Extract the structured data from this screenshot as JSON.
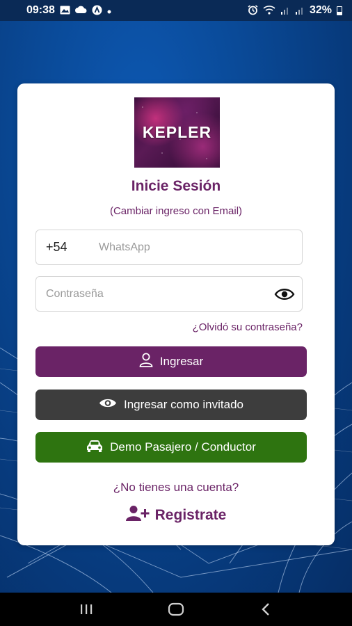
{
  "status_bar": {
    "time": "09:38",
    "battery_percent": "32%",
    "icons_left": [
      "image-icon",
      "cloud-icon",
      "app-a-icon",
      "dot-icon"
    ],
    "icons_right": [
      "alarm-icon",
      "wifi-icon",
      "signal-icon",
      "signal-icon",
      "battery-icon"
    ]
  },
  "logo": {
    "text": "KEPLER"
  },
  "login": {
    "title": "Inicie Sesión",
    "switch_label": "(Cambiar ingreso con Email)",
    "phone_prefix": "+54",
    "phone_placeholder": "WhatsApp",
    "password_placeholder": "Contraseña",
    "forgot_label": "¿Olvidó su contraseña?",
    "login_button": "Ingresar",
    "guest_button": "Ingresar como invitado",
    "demo_button": "Demo Pasajero / Conductor",
    "no_account_label": "¿No tienes una cuenta?",
    "register_label": "Registrate"
  },
  "colors": {
    "brand_purple": "#6a2366",
    "guest_gray": "#3d3d3d",
    "demo_green": "#2e7410",
    "background_blue": "#0b4a98"
  },
  "nav_bar": {
    "icons": [
      "recent-apps-icon",
      "home-icon",
      "back-icon"
    ]
  }
}
